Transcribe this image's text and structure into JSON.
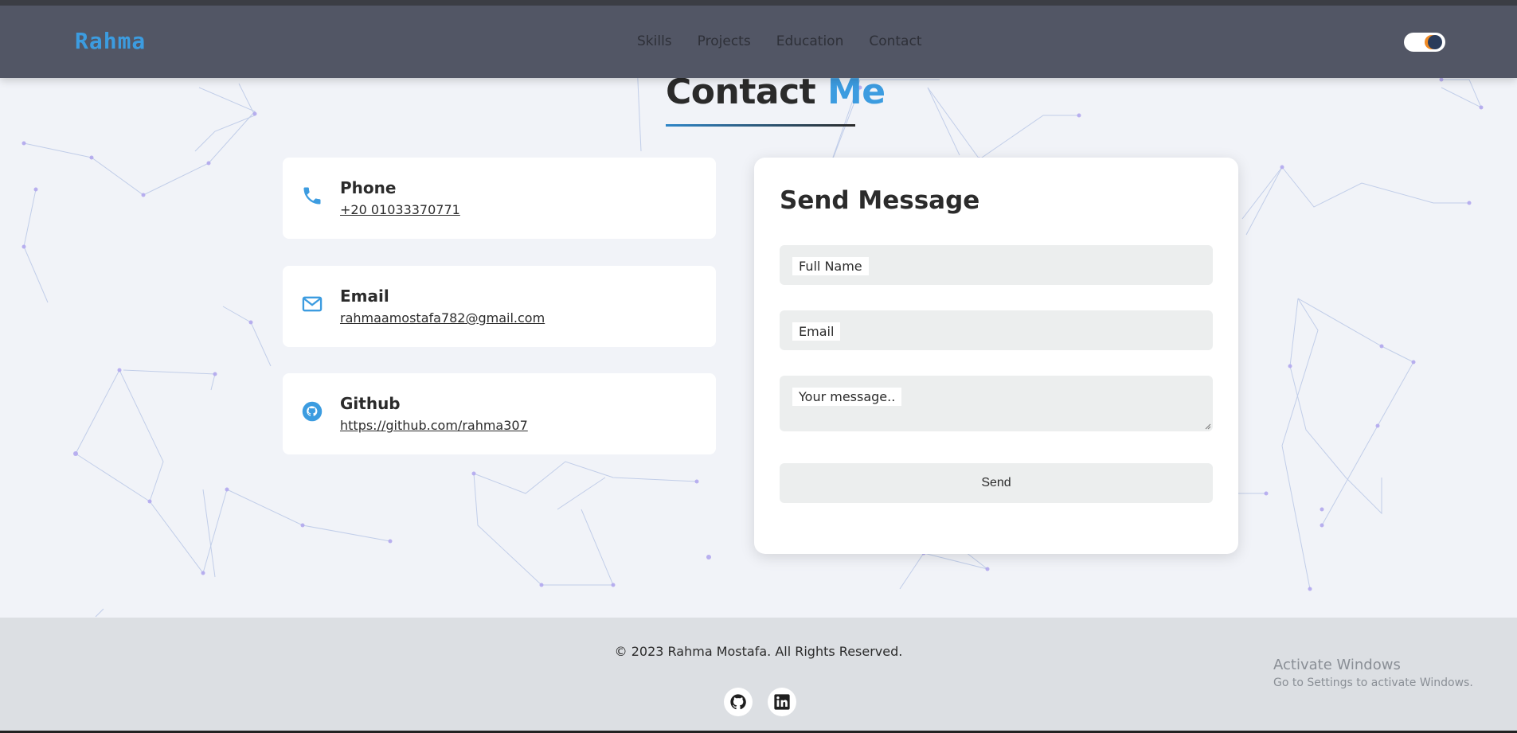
{
  "navbar": {
    "logo": "Rahma",
    "links": [
      "Skills",
      "Projects",
      "Education",
      "Contact"
    ],
    "theme_toggle": "theme-toggle"
  },
  "section": {
    "title_main": "Contact",
    "title_accent": "Me"
  },
  "contact_cards": [
    {
      "label": "Phone",
      "value": "+20 01033370771",
      "icon": "phone-icon"
    },
    {
      "label": "Email",
      "value": "rahmaamostafa782@gmail.com",
      "icon": "mail-icon"
    },
    {
      "label": "Github",
      "value": "https://github.com/rahma307",
      "icon": "github-icon"
    }
  ],
  "form": {
    "title": "Send Message",
    "name_placeholder": "Full Name",
    "email_placeholder": "Email",
    "message_placeholder": "Your message..",
    "send_label": "Send"
  },
  "footer": {
    "copyright": "© 2023 Rahma Mostafa. All Rights Reserved.",
    "socials": [
      "github-icon",
      "linkedin-icon"
    ]
  },
  "os_watermark": {
    "title": "Activate Windows",
    "subtitle": "Go to Settings to activate Windows."
  },
  "colors": {
    "accent": "#3c9ce0",
    "navbar": "#525665",
    "page_bg": "#f1f3f8",
    "footer_bg": "#dcdfe3",
    "field_bg": "#eceeee"
  }
}
